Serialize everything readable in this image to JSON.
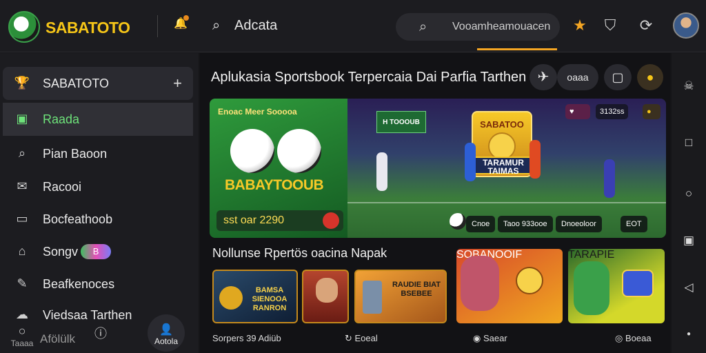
{
  "brand": {
    "name": "SABATOTO"
  },
  "topbar": {
    "search_label": "Adcata",
    "search_placeholder": "Vooamheamouacen"
  },
  "sidebar": {
    "header": "SABATOTO",
    "items": [
      {
        "label": "Raada",
        "icon": "wallet-icon"
      },
      {
        "label": "Pian Baoon",
        "icon": "search-icon"
      },
      {
        "label": "Racooi",
        "icon": "mail-icon"
      },
      {
        "label": "Bocfeathoob",
        "icon": "tv-icon"
      },
      {
        "label": "Songv",
        "icon": "home-icon",
        "badge": "B"
      },
      {
        "label": "Beafkenoces",
        "icon": "edit-icon"
      },
      {
        "label": "Viedsaa Tarthen",
        "icon": "cloud-icon"
      }
    ],
    "bottom": [
      "Taaaa",
      "Afölülk",
      "Aotola"
    ]
  },
  "main": {
    "headline": "Aplukasia Sportsbook Terpercaia  Dai Parfia Tarthen",
    "head_buttons": [
      "oaaa"
    ],
    "hero": {
      "left_top": "Enoac  Meer Sooooa",
      "left_brand": "BABAYTOOUB",
      "left_bar": "sst oar 2290",
      "tag": "H TOOOUB",
      "emblem_title": "SABATOO",
      "emblem_text": "TARAMUR TAIMAS",
      "right_chips": [
        "3132ss"
      ],
      "foot": [
        "Cnoe",
        "Taoo 933ooe",
        "Dnoeoloor",
        "EOT"
      ]
    },
    "section_title": "Nollunse Rpertös oacina Napak",
    "cards": [
      {
        "text": "BAMSA SIENOOA RANRON"
      },
      {
        "text": ""
      },
      {
        "text": "RAUDIE BIAT BSEBEE"
      },
      {
        "text": "SOBANOOIF"
      },
      {
        "text": "TARAPIE"
      }
    ],
    "footer": [
      "Sorpers 39 Adiüb",
      "Eoeal",
      "Saear",
      "Boeaa"
    ]
  },
  "colors": {
    "accent": "#f5a623",
    "brand_gold": "#f5c518",
    "active_green": "#6ee37a",
    "bg": "#151518"
  }
}
